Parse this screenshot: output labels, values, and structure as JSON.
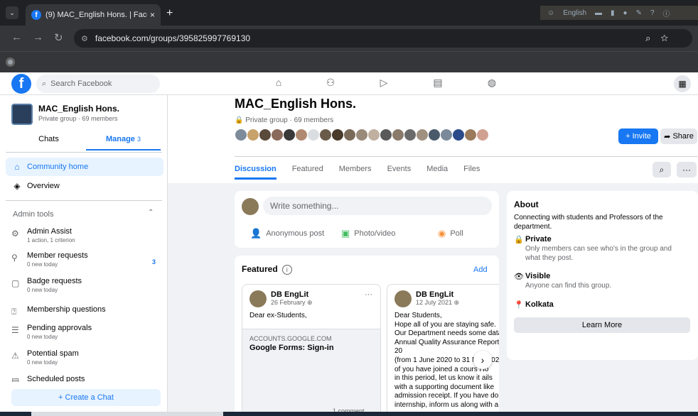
{
  "browser": {
    "tab_title": "(9) MAC_English Hons. | Facebo",
    "tab_close": "×",
    "new_tab": "+",
    "url": "facebook.com/groups/395825997769130",
    "ext_text": "English"
  },
  "fb": {
    "search_placeholder": "Search Facebook",
    "logo": "f"
  },
  "sidebar": {
    "group_name": "MAC_English Hons.",
    "group_sub": "Private group · 69 members",
    "tab_chats": "Chats",
    "tab_manage": "Manage",
    "manage_count": "3",
    "community_home": "Community home",
    "overview": "Overview",
    "admin_tools": "Admin tools",
    "admin_items": [
      {
        "title": "Admin Assist",
        "sub": "1 action, 1 criterion"
      },
      {
        "title": "Member requests",
        "sub": "0 new today"
      },
      {
        "title": "Badge requests",
        "sub": "0 new today"
      },
      {
        "title": "Membership questions",
        "sub": ""
      },
      {
        "title": "Pending approvals",
        "sub": "0 new today"
      },
      {
        "title": "Potential spam",
        "sub": "0 new today"
      },
      {
        "title": "Scheduled posts",
        "sub": ""
      }
    ],
    "member_requests_badge": "3",
    "create_chat": "+ Create a Chat"
  },
  "group": {
    "title": "MAC_English Hons.",
    "subtitle": "Private group · 69 members",
    "invite": "+ Invite",
    "share": "Share",
    "tabs": [
      "Discussion",
      "Featured",
      "Members",
      "Events",
      "Media",
      "Files"
    ],
    "more": "···"
  },
  "composer": {
    "placeholder": "Write something...",
    "anonymous": "Anonymous post",
    "photo": "Photo/video",
    "poll": "Poll"
  },
  "featured": {
    "heading": "Featured",
    "info": "i",
    "add": "Add",
    "posts": [
      {
        "author": "DB EngLit",
        "date": "26 February",
        "body": "Dear ex-Students,",
        "link_domain": "ACCOUNTS.GOOGLE.COM",
        "link_title": "Google Forms: Sign-in"
      },
      {
        "author": "DB EngLit",
        "date": "12 July 2021",
        "body": "Dear Students,\nHope all of you are staying safe.\nOur Department needs some data f\nAnnual Quality Assurance Report 20\n(from 1 June 2020 to 31 May 2021).\nof you have joined a cours    Ho\nin this period, let us know it    ails\nwith a supporting document like\nadmission receipt. If you have done\ninternship, inform us along with a c"
      }
    ],
    "comment_count": "1 comment"
  },
  "about": {
    "title": "About",
    "description": "Connecting with students and Professors of the department.",
    "private_title": "Private",
    "private_desc": "Only members can see who's in the group and what they post.",
    "visible_title": "Visible",
    "visible_desc": "Anyone can find this group.",
    "location": "Kolkata",
    "learn_more": "Learn More"
  },
  "colors": {
    "brand": "#1877f2",
    "bg": "#f0f2f5"
  }
}
